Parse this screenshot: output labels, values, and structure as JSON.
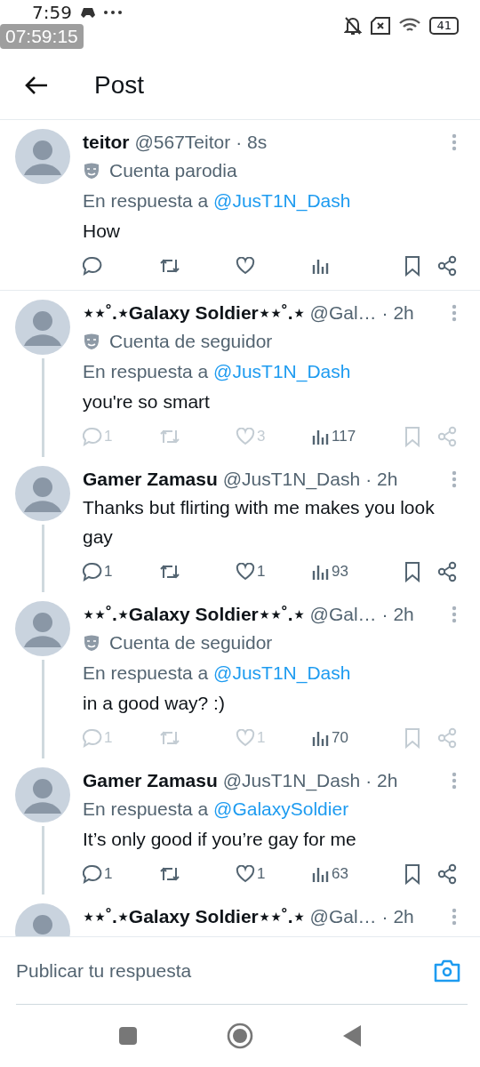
{
  "status_bar": {
    "time": "7:59",
    "battery": "41",
    "recording_timer": "07:59:15"
  },
  "header": {
    "title": "Post"
  },
  "posts": [
    {
      "name": "teitor",
      "handle": "@567Teitor",
      "time": "· 8s",
      "badge": "Cuenta parodia",
      "reply_prefix": "En respuesta a",
      "reply_to": "@JusT1N_Dash",
      "text": "How",
      "faded": false,
      "thread_below": false,
      "divider": true
    },
    {
      "name": "⋆⋆˚.⋆Galaxy Soldier⋆⋆˚.⋆",
      "handle": "@Gal…",
      "time": "· 2h",
      "badge": "Cuenta de seguidor",
      "reply_prefix": "En respuesta a",
      "reply_to": "@JusT1N_Dash",
      "text": "you're so smart",
      "faded": true,
      "thread_below": true,
      "divider": false,
      "actions": {
        "replies": "1",
        "likes": "3",
        "views": "117"
      }
    },
    {
      "name": "Gamer Zamasu",
      "handle": "@JusT1N_Dash",
      "time": "· 2h",
      "text": "Thanks but flirting with me makes you look gay",
      "faded": false,
      "thread_below": true,
      "divider": false,
      "actions": {
        "replies": "1",
        "likes": "1",
        "views": "93"
      }
    },
    {
      "name": "⋆⋆˚.⋆Galaxy Soldier⋆⋆˚.⋆",
      "handle": "@Gal…",
      "time": "· 2h",
      "badge": "Cuenta de seguidor",
      "reply_prefix": "En respuesta a",
      "reply_to": "@JusT1N_Dash",
      "text": "in a good way? :)",
      "faded": true,
      "thread_below": true,
      "divider": false,
      "actions": {
        "replies": "1",
        "likes": "1",
        "views": "70"
      }
    },
    {
      "name": "Gamer Zamasu",
      "handle": "@JusT1N_Dash",
      "time": "· 2h",
      "reply_prefix": "En respuesta a",
      "reply_to": "@GalaxySoldier",
      "text": "It’s only good if you’re gay for me",
      "faded": false,
      "thread_below": true,
      "divider": false,
      "actions": {
        "replies": "1",
        "likes": "1",
        "views": "63"
      }
    },
    {
      "name": "⋆⋆˚.⋆Galaxy Soldier⋆⋆˚.⋆",
      "handle": "@Gal…",
      "time": "· 2h",
      "thread_below": false,
      "divider": false,
      "partial": true
    }
  ],
  "reply_bar": {
    "placeholder": "Publicar tu respuesta"
  }
}
